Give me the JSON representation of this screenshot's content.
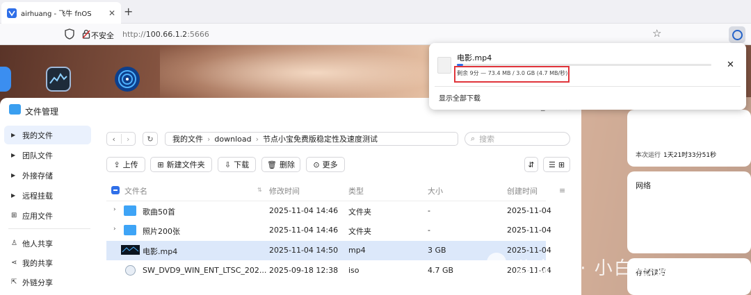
{
  "browser": {
    "tab_title": "airhuang - 飞牛 fnOS",
    "tab_close": "✕",
    "new_tab": "+",
    "insecure_label": "不安全",
    "url_prefix": "http://",
    "url_host": "100.66.1.2",
    "url_port": ":5666"
  },
  "download_popup": {
    "filename": "电影.mp4",
    "status": "剩余 9分 — 73.4 MB / 3.0 GB (4.7 MB/秒)",
    "show_all": "显示全部下载",
    "progress": 0.024,
    "close": "✕"
  },
  "file_manager": {
    "title": "文件管理",
    "sidebar": [
      {
        "label": "我的文件",
        "icon": "caret-right-icon",
        "active": true
      },
      {
        "label": "团队文件",
        "icon": "caret-right-icon"
      },
      {
        "label": "外接存储",
        "icon": "caret-right-icon"
      },
      {
        "label": "远程挂载",
        "icon": "caret-right-icon"
      },
      {
        "label": "应用文件",
        "icon": "apps-icon"
      },
      {
        "label": "他人共享",
        "icon": "user-icon"
      },
      {
        "label": "我的共享",
        "icon": "share-icon"
      },
      {
        "label": "外链分享",
        "icon": "external-link-icon"
      }
    ],
    "breadcrumb": [
      "我的文件",
      "download",
      "节点小宝免费版稳定性及速度测试"
    ],
    "search_placeholder": "搜索",
    "actions": {
      "upload": "上传",
      "new_folder": "新建文件夹",
      "download": "下载",
      "delete": "删除",
      "more": "更多"
    },
    "columns": {
      "name": "文件名",
      "modified": "修改时间",
      "type": "类型",
      "size": "大小",
      "created": "创建时间"
    },
    "rows": [
      {
        "name": "歌曲50首",
        "modified": "2025-11-04 14:46",
        "type": "文件夹",
        "size": "-",
        "created": "2025-11-04",
        "kind": "folder"
      },
      {
        "name": "照片200张",
        "modified": "2025-11-04 14:46",
        "type": "文件夹",
        "size": "-",
        "created": "2025-11-04",
        "kind": "folder"
      },
      {
        "name": "电影.mp4",
        "modified": "2025-11-04 14:50",
        "type": "mp4",
        "size": "3 GB",
        "created": "2025-11-04",
        "kind": "video"
      },
      {
        "name": "SW_DVD9_WIN_ENT_LTSC_202...",
        "modified": "2025-09-18 12:38",
        "type": "iso",
        "size": "4.7 GB",
        "created": "2025-11-04",
        "kind": "iso"
      }
    ]
  },
  "right_panel": {
    "uptime_label": "本次运行",
    "uptime_value": "1天21时33分51秒",
    "network_label": "网络",
    "storage_label": "存储读写"
  },
  "watermark": "公众号 · 小白电脑技术",
  "colors": {
    "accent": "#2f6fe8",
    "highlight_box": "#e0343a",
    "selected_row": "#dce8fa"
  }
}
